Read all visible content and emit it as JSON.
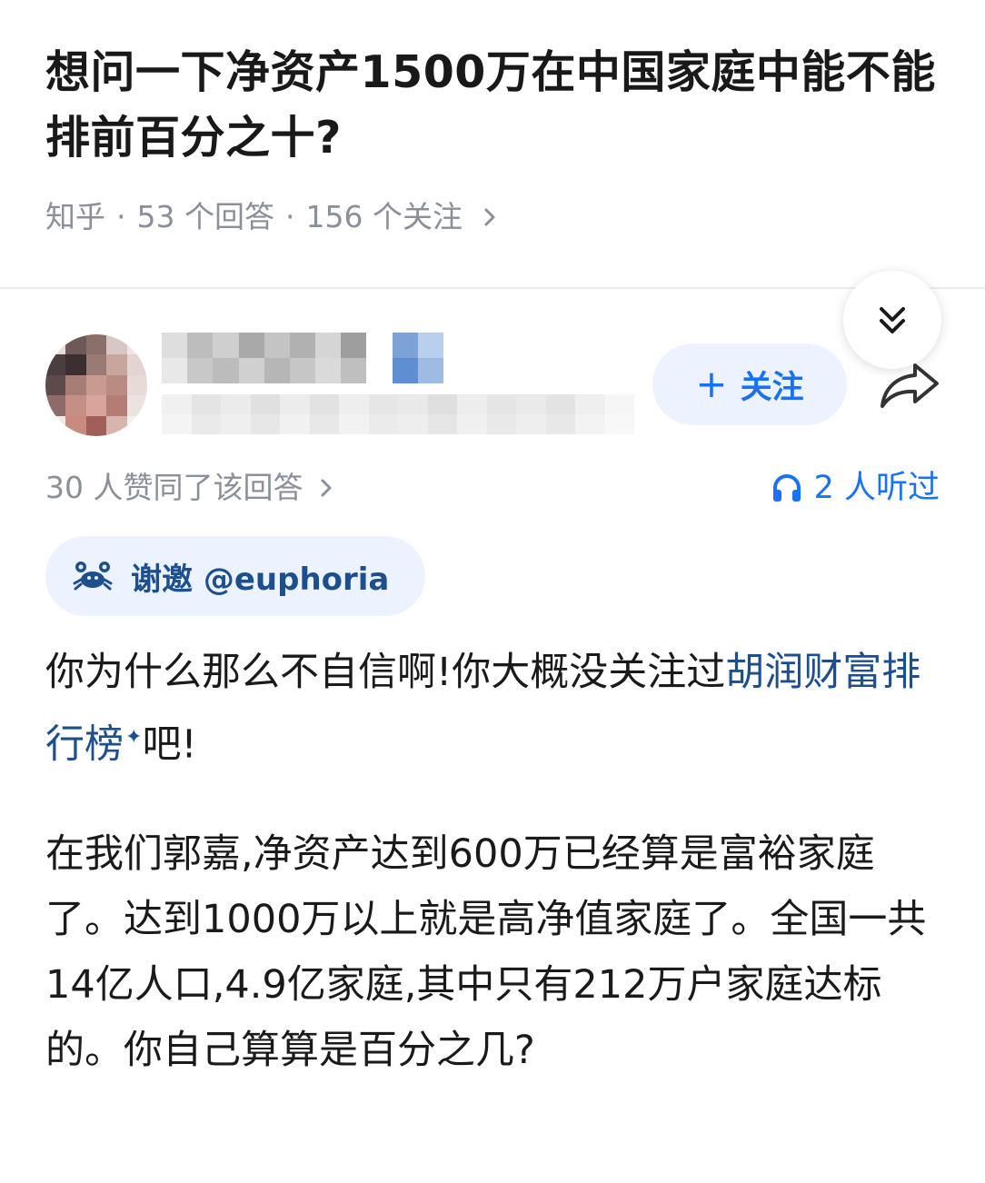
{
  "question": {
    "title": "想问一下净资产1500万在中国家庭中能不能排前百分之十?",
    "source": "知乎",
    "answers": "53 个回答",
    "followers": "156 个关注",
    "separator": "·"
  },
  "author": {
    "avatar": "blurred-avatar",
    "follow_label": "关注",
    "follow_plus": "+"
  },
  "stats": {
    "likes": "30 人赞同了该回答",
    "listens": "2 人听过"
  },
  "invite": {
    "label": "谢邀 @euphoria"
  },
  "answer": {
    "p1_text": "你为什么那么不自信啊!你大概没关注过",
    "p1_link": "胡润财富排行榜",
    "p1_spark": "✦",
    "p1_end": "吧!",
    "p2": "在我们郭嘉,净资产达到600万已经算是富裕家庭了。达到1000万以上就是高净值家庭了。全国一共14亿人口,4.9亿家庭,其中只有212万户家庭达标的。你自己算算是百分之几?"
  },
  "colors": {
    "accent": "#1772f6",
    "link": "#1d4f8f",
    "muted": "#8a8f99",
    "pill_bg": "#ecf3ff"
  },
  "icons": {
    "collapse": "double-chevron-down-icon",
    "share": "share-arrow-icon",
    "headphones": "headphones-icon",
    "invite": "crab-icon",
    "chevron": "chevron-right-icon"
  }
}
